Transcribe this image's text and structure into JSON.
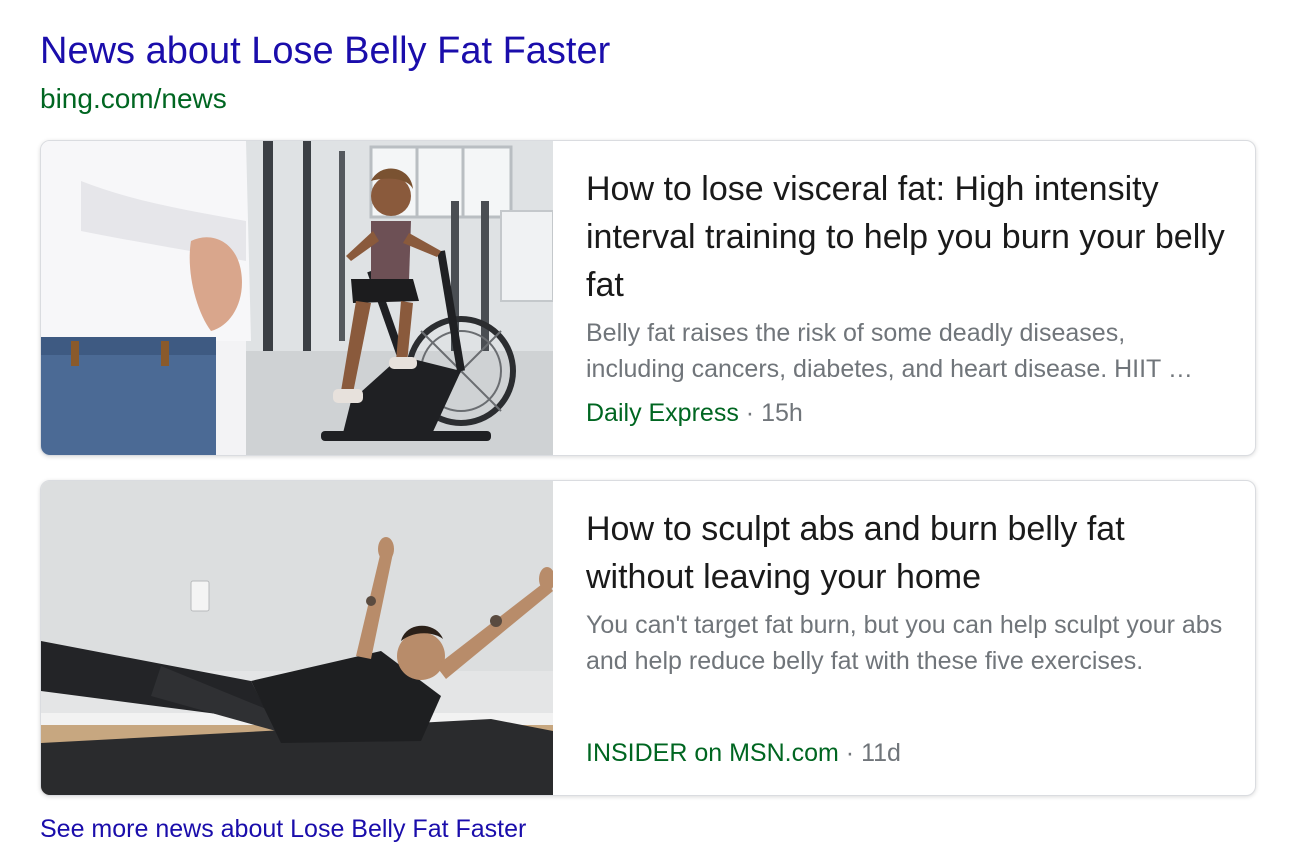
{
  "news_block": {
    "heading": "News about Lose Belly Fat Faster",
    "source_url": "bing.com/news",
    "more_link": "See more news about Lose Belly Fat Faster"
  },
  "articles": [
    {
      "title": "How to lose visceral fat: High intensity interval training to help you burn your belly fat",
      "snippet": "Belly fat raises the risk of some deadly diseases, including cancers, diabetes, and heart disease. HIIT …",
      "publisher": "Daily Express",
      "separator": "·",
      "age": "15h",
      "image": "woman on exercise bike beside man holding belly"
    },
    {
      "title": "How to sculpt abs and burn belly fat without leaving your home",
      "snippet": "You can't target fat burn, but you can help sculpt your abs and help reduce belly fat with these five exercises.",
      "publisher": "INSIDER on MSN.com",
      "separator": "·",
      "age": "11d",
      "image": "man doing ab exercise on floor mat"
    }
  ],
  "colors": {
    "link": "#1a0dab",
    "url_green": "#006621",
    "title_text": "#1a1a1a",
    "muted_text": "#70757a"
  }
}
